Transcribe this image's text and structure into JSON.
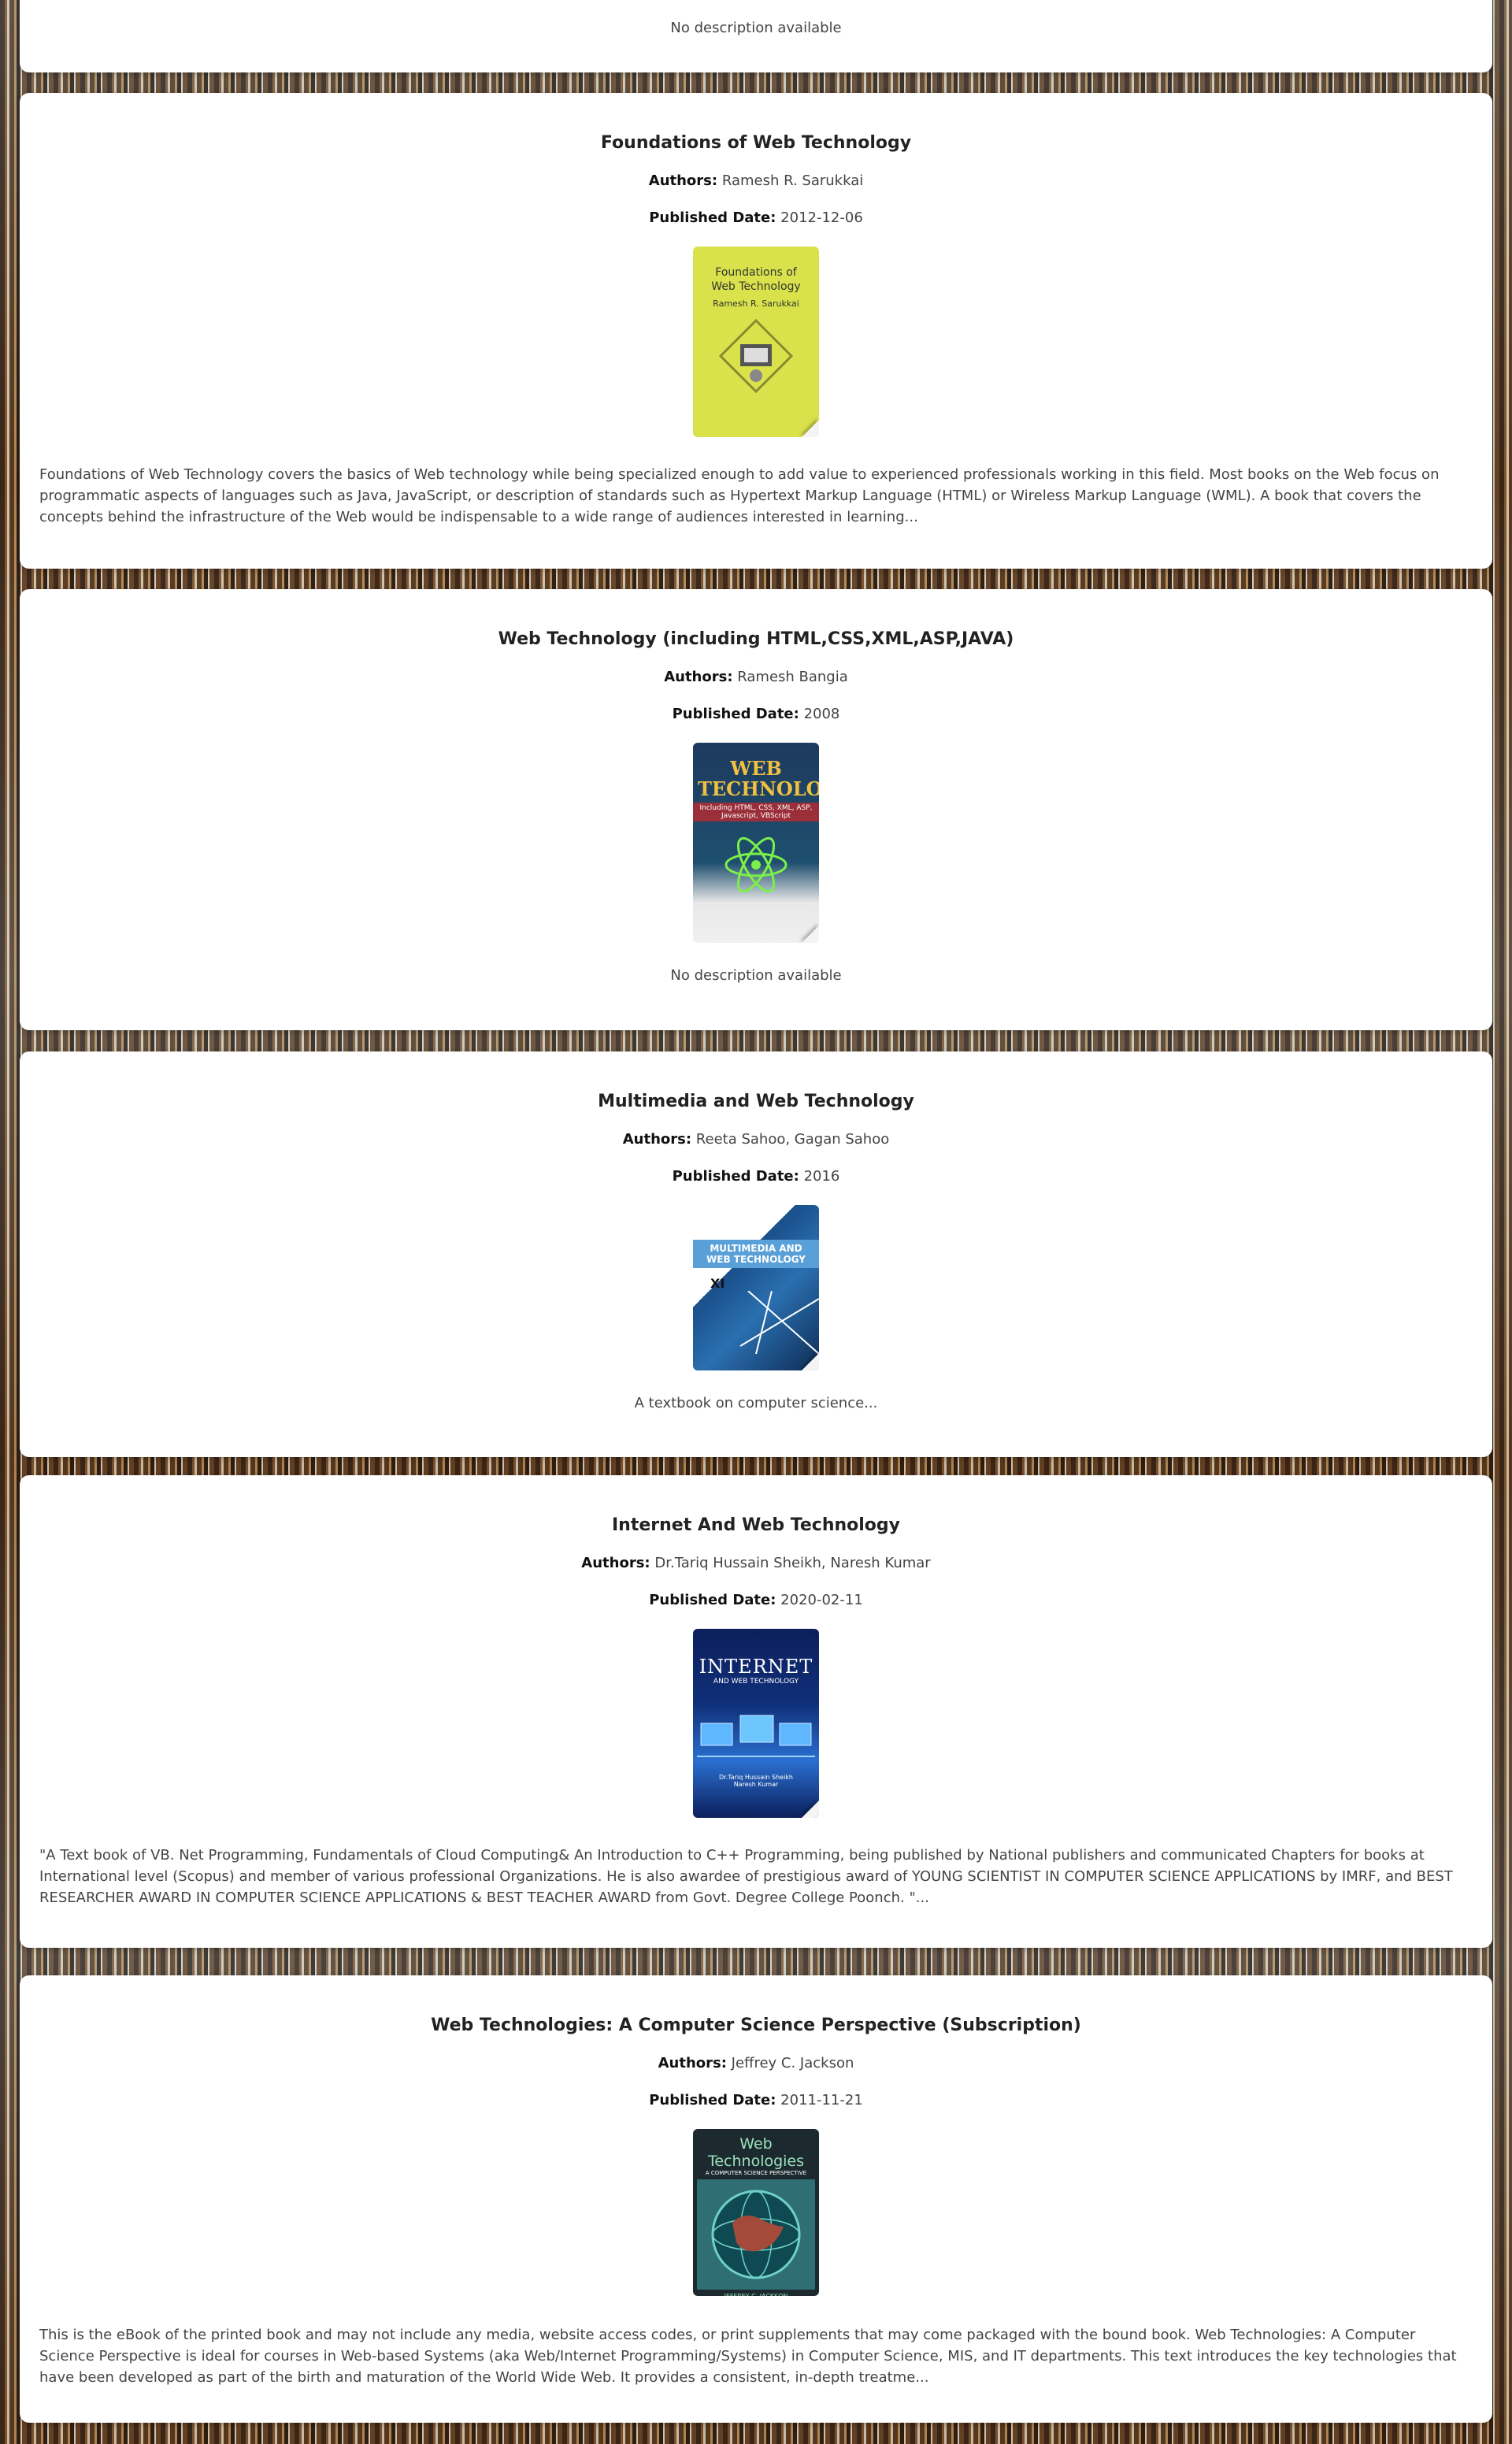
{
  "labels": {
    "authors": "Authors:",
    "published": "Published Date:"
  },
  "books": [
    {
      "description": "No description available"
    },
    {
      "title": "Foundations of Web Technology",
      "authors": "Ramesh R. Sarukkai",
      "published": "2012-12-06",
      "cover": {
        "title": "Foundations of Web Technology",
        "author": "Ramesh R. Sarukkai",
        "color": "#d9e24a"
      },
      "description": "Foundations of Web Technology covers the basics of Web technology while being specialized enough to add value to experienced professionals working in this field. Most books on the Web focus on programmatic aspects of languages such as Java, JavaScript, or description of standards such as Hypertext Markup Language (HTML) or Wireless Markup Language (WML). A book that covers the concepts behind the infrastructure of the Web would be indispensable to a wide range of audiences interested in learning..."
    },
    {
      "title": "Web Technology (including HTML,CSS,XML,ASP,JAVA)",
      "authors": "Ramesh Bangia",
      "published": "2008",
      "cover": {
        "title": "WEB TECHNOLOGY",
        "subtitle": "Including HTML, CSS, XML, ASP, Javascript, VBScript",
        "color": "#1d3a5e"
      },
      "description": "No description available"
    },
    {
      "title": "Multimedia and Web Technology",
      "authors": "Reeta Sahoo, Gagan Sahoo",
      "published": "2016",
      "cover": {
        "title": "MULTIMEDIA AND WEB TECHNOLOGY",
        "grade": "XI",
        "color": "#1a4f8a"
      },
      "description": "A textbook on computer science..."
    },
    {
      "title": "Internet And Web Technology",
      "authors": "Dr.Tariq Hussain Sheikh, Naresh Kumar",
      "published": "2020-02-11",
      "cover": {
        "title": "INTERNET",
        "subtitle": "AND WEB TECHNOLOGY",
        "author": "Dr.Tariq Hussain Sheikh Naresh Kumar",
        "color": "#10307a"
      },
      "description": "\"A Text book of VB. Net Programming, Fundamentals of Cloud Computing& An Introduction to C++ Programming, being published by National publishers and communicated Chapters for books at International level (Scopus) and member of various professional Organizations. He is also awardee of prestigious award of YOUNG SCIENTIST IN COMPUTER SCIENCE APPLICATIONS by IMRF, and BEST RESEARCHER AWARD IN COMPUTER SCIENCE APPLICATIONS & BEST TEACHER AWARD from Govt. Degree College Poonch. \"..."
    },
    {
      "title": "Web Technologies: A Computer Science Perspective (Subscription)",
      "authors": "Jeffrey C. Jackson",
      "published": "2011-11-21",
      "cover": {
        "title": "Web Technologies",
        "subtitle": "A COMPUTER SCIENCE PERSPECTIVE",
        "author": "JEFFREY C. JACKSON",
        "color": "#1c2a30"
      },
      "description": "This is the eBook of the printed book and may not include any media, website access codes, or print supplements that may come packaged with the bound book. Web Technologies: A Computer Science Perspective is ideal for courses in Web-based Systems (aka Web/Internet Programming/Systems) in Computer Science, MIS, and IT departments. This text introduces the key technologies that have been developed as part of the birth and maturation of the World Wide Web. It provides a consistent, in-depth treatme..."
    }
  ]
}
